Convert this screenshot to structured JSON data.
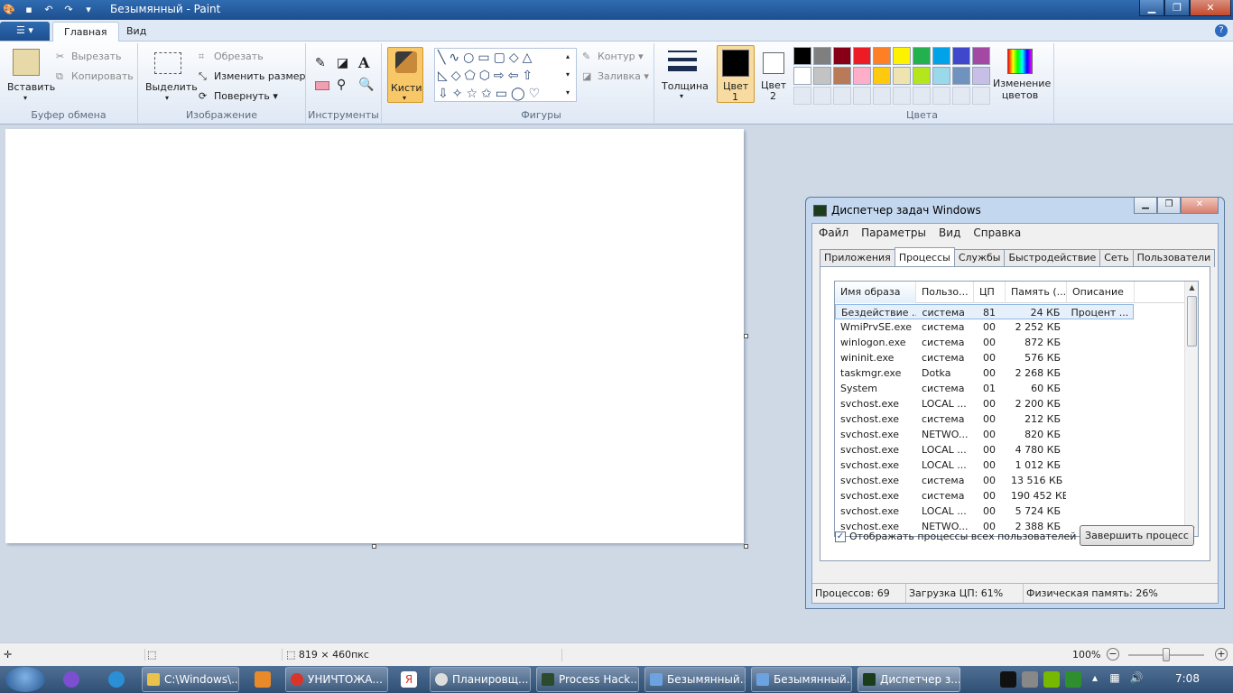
{
  "window": {
    "title": "Безымянный - Paint"
  },
  "colors": {
    "accent": "#2c5f9e",
    "ribbon_bg": "#f5f8fc",
    "canvas_bg": "#cfd9e6",
    "selected_brush": "#f8c768"
  },
  "ribbon": {
    "app_menu_icon": "menu-icon",
    "tabs": [
      "Главная",
      "Вид"
    ],
    "clipboard": {
      "paste": "Вставить",
      "cut": "Вырезать",
      "copy": "Копировать",
      "label": "Буфер обмена"
    },
    "image": {
      "select": "Выделить",
      "crop": "Обрезать",
      "resize": "Изменить размер",
      "rotate": "Повернуть",
      "label": "Изображение"
    },
    "tools": {
      "label": "Инструменты"
    },
    "brushes": {
      "label": "Кисти"
    },
    "shapes": {
      "outline": "Контур",
      "fill": "Заливка",
      "label": "Фигуры"
    },
    "size": {
      "label": "Толщина"
    },
    "color1": {
      "label1": "Цвет",
      "label2": "1",
      "value": "#000000"
    },
    "color2": {
      "label1": "Цвет",
      "label2": "2",
      "value": "#ffffff"
    },
    "palette": [
      "#000000",
      "#7f7f7f",
      "#880015",
      "#ed1c24",
      "#ff7f27",
      "#fff200",
      "#22b14c",
      "#00a2e8",
      "#3f48cc",
      "#a349a4",
      "#ffffff",
      "#c3c3c3",
      "#b97a57",
      "#ffaec9",
      "#ffc90e",
      "#efe4b0",
      "#b5e61d",
      "#99d9ea",
      "#7092be",
      "#c8bfe7"
    ],
    "colors_label": "Цвета",
    "edit_colors": {
      "line1": "Изменение",
      "line2": "цветов"
    }
  },
  "statusbar": {
    "size": "819 × 460пкс",
    "zoom": "100%"
  },
  "taskmanager": {
    "title": "Диспетчер задач Windows",
    "menu": [
      "Файл",
      "Параметры",
      "Вид",
      "Справка"
    ],
    "tabs": [
      "Приложения",
      "Процессы",
      "Службы",
      "Быстродействие",
      "Сеть",
      "Пользователи"
    ],
    "columns": [
      "Имя образа",
      "Пользо...",
      "ЦП",
      "Память (...",
      "Описание"
    ],
    "rows": [
      [
        "Бездействие ...",
        "система",
        "81",
        "24 КБ",
        "Процент ..."
      ],
      [
        "WmiPrvSE.exe",
        "система",
        "00",
        "2 252 КБ",
        ""
      ],
      [
        "winlogon.exe",
        "система",
        "00",
        "872 КБ",
        ""
      ],
      [
        "wininit.exe",
        "система",
        "00",
        "576 КБ",
        ""
      ],
      [
        "taskmgr.exe",
        "Dotka",
        "00",
        "2 268 КБ",
        ""
      ],
      [
        "System",
        "система",
        "01",
        "60 КБ",
        ""
      ],
      [
        "svchost.exe",
        "LOCAL ...",
        "00",
        "2 200 КБ",
        ""
      ],
      [
        "svchost.exe",
        "система",
        "00",
        "212 КБ",
        ""
      ],
      [
        "svchost.exe",
        "NETWO...",
        "00",
        "820 КБ",
        ""
      ],
      [
        "svchost.exe",
        "LOCAL ...",
        "00",
        "4 780 КБ",
        ""
      ],
      [
        "svchost.exe",
        "LOCAL ...",
        "00",
        "1 012 КБ",
        ""
      ],
      [
        "svchost.exe",
        "система",
        "00",
        "13 516 КБ",
        ""
      ],
      [
        "svchost.exe",
        "система",
        "00",
        "190 452 КБ",
        ""
      ],
      [
        "svchost.exe",
        "LOCAL ...",
        "00",
        "5 724 КБ",
        ""
      ],
      [
        "svchost.exe",
        "NETWO...",
        "00",
        "2 388 КБ",
        ""
      ]
    ],
    "show_all": "Отображать процессы всех пользователей",
    "end_process": "Завершить процесс",
    "status": {
      "processes": "Процессов: 69",
      "cpu": "Загрузка ЦП: 61%",
      "memory": "Физическая память: 26%"
    }
  },
  "taskbar": {
    "items": [
      "C:\\Windows\\...",
      "УНИЧТОЖА...",
      "Планировщ...",
      "Process Hack...",
      "Безымянный...",
      "Безымянный...",
      "Диспетчер з..."
    ],
    "clock": "7:08"
  }
}
